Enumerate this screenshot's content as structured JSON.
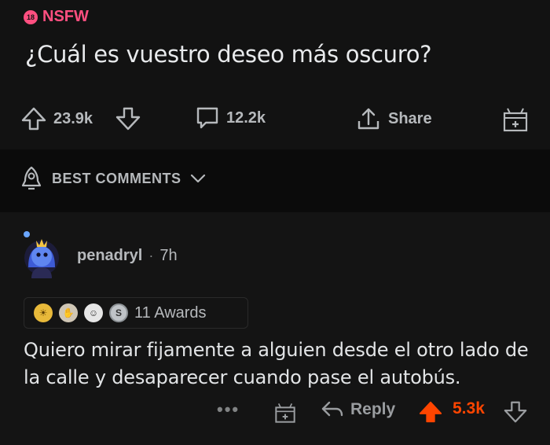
{
  "post": {
    "nsfw_badge": "18",
    "nsfw_label": "NSFW",
    "title": "¿Cuál es vuestro deseo más oscuro?",
    "upvotes": "23.9k",
    "comments": "12.2k",
    "share_label": "Share"
  },
  "sort": {
    "label": "BEST COMMENTS"
  },
  "comment": {
    "username": "penadryl",
    "separator": "·",
    "age": "7h",
    "awards_label": "11 Awards",
    "body": "Quiero mirar fijamente a alguien desde el otro lado de la calle y desaparecer cuando pase el autobús.",
    "more": "•••",
    "reply_label": "Reply",
    "score": "5.3k"
  },
  "colors": {
    "nsfw": "#ff4f80",
    "upvote_active": "#ff4500",
    "background": "#0f0f0f"
  },
  "icons": {
    "upvote": "arrow-up-icon",
    "downvote": "arrow-down-icon",
    "comments": "speech-bubble-icon",
    "share": "share-upload-icon",
    "award": "gift-icon",
    "sort": "rocket-icon",
    "reply": "reply-arrow-icon"
  }
}
